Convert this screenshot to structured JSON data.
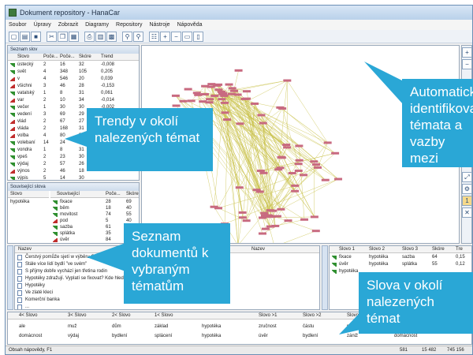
{
  "window": {
    "title": "Dokument repository - HanaCar"
  },
  "menu": [
    "Soubor",
    "Úpravy",
    "Zobrazit",
    "Diagramy",
    "Repository",
    "Nástroje",
    "Nápověda"
  ],
  "words_panel": {
    "header": "Seznam slov",
    "columns": [
      "Slovo",
      "Poče...",
      "Poče...",
      "Skóre",
      "Trend"
    ],
    "rows": [
      {
        "trend": "up",
        "cells": [
          "ústecký",
          "2",
          "16",
          "32",
          "-0,008"
        ]
      },
      {
        "trend": "up",
        "cells": [
          "svět",
          "4",
          "348",
          "105",
          "0,205"
        ]
      },
      {
        "trend": "down",
        "cells": [
          "v",
          "4",
          "546",
          "20",
          "0,039"
        ]
      },
      {
        "trend": "down",
        "cells": [
          "všichni",
          "3",
          "46",
          "28",
          "-0,153"
        ]
      },
      {
        "trend": "up",
        "cells": [
          "vatalský",
          "1",
          "8",
          "31",
          "0,061"
        ]
      },
      {
        "trend": "down",
        "cells": [
          "var",
          "2",
          "10",
          "34",
          "-0,014"
        ]
      },
      {
        "trend": "up",
        "cells": [
          "večer",
          "1",
          "30",
          "30",
          "-0,002"
        ]
      },
      {
        "trend": "up",
        "cells": [
          "vedení",
          "3",
          "69",
          "29",
          "0,151"
        ]
      },
      {
        "trend": "down",
        "cells": [
          "vlád",
          "2",
          "67",
          "27",
          ""
        ]
      },
      {
        "trend": "down",
        "cells": [
          "vláda",
          "2",
          "168",
          "31",
          ""
        ]
      },
      {
        "trend": "down",
        "cells": [
          "volba",
          "4",
          "80",
          "36",
          ""
        ]
      },
      {
        "trend": "up",
        "cells": [
          "volebaní",
          "14",
          "24",
          "30",
          ""
        ]
      },
      {
        "trend": "up",
        "cells": [
          "vondra",
          "1",
          "8",
          "31",
          ""
        ]
      },
      {
        "trend": "up",
        "cells": [
          "vpeš",
          "2",
          "23",
          "30",
          ""
        ]
      },
      {
        "trend": "up",
        "cells": [
          "výdaj",
          "2",
          "57",
          "26",
          ""
        ]
      },
      {
        "trend": "down",
        "cells": [
          "výnos",
          "2",
          "46",
          "18",
          ""
        ]
      },
      {
        "trend": "up",
        "cells": [
          "výpis",
          "5",
          "14",
          "30",
          ""
        ]
      }
    ]
  },
  "related_panel": {
    "header": "Související slova",
    "columns_left": [
      "Slovo"
    ],
    "left_rows": [
      "hypotéka"
    ],
    "columns_right": [
      "Související",
      "Poče...",
      "Skóre"
    ],
    "rows": [
      {
        "trend": "up",
        "cells": [
          "fixace",
          "28",
          "69"
        ]
      },
      {
        "trend": "up",
        "cells": [
          "běm",
          "18",
          "40"
        ]
      },
      {
        "trend": "up",
        "cells": [
          "movitost",
          "74",
          "55"
        ]
      },
      {
        "trend": "down",
        "cells": [
          "pod",
          "5",
          "40"
        ]
      },
      {
        "trend": "up",
        "cells": [
          "sazba",
          "61",
          "46"
        ]
      },
      {
        "trend": "up",
        "cells": [
          "splátka",
          "35",
          "45"
        ]
      },
      {
        "trend": "down",
        "cells": [
          "úvěr",
          "84",
          "45"
        ]
      }
    ]
  },
  "documents_panel": {
    "header": "Nazev",
    "col2": "Nazev",
    "rows": [
      "Čerstvý pomůže sjetí w výběru Obcemi ...",
      "Stále více lidí bydlí \"ve svém\"",
      "S příjmy dobře vychází jen třetina rodin",
      "Hypotéky zdražují. Vyplatí se fixovat? Kde hledat...",
      "Hypotéky",
      "Ve zlaté kleci",
      "Komerční banka",
      "..."
    ]
  },
  "pairs_panel": {
    "columns": [
      "Slovo 1",
      "Slovo 2",
      "Slovo 3",
      "Skóre",
      "Tre"
    ],
    "rows": [
      {
        "trend": "up",
        "cells": [
          "fixace",
          "hypotéka",
          "sazba",
          "64",
          "0,15"
        ]
      },
      {
        "trend": "up",
        "cells": [
          "úvěr",
          "hypotéka",
          "splátka",
          "55",
          "0,12"
        ]
      },
      {
        "trend": "up",
        "cells": [
          "hypotéka",
          "",
          "",
          "",
          ""
        ]
      }
    ]
  },
  "context_panel": {
    "columns": [
      "4< Slovo",
      "3< Slovo",
      "2< Slovo",
      "1< Slovo",
      "",
      "Slovo >1",
      "Slovo >2",
      "Slovo >3",
      "Slovo >4"
    ],
    "rows": [
      [
        "ale",
        "muž",
        "dům",
        "základ",
        "hypotéka",
        "zručnost",
        "částu",
        "po",
        "sumáření"
      ],
      [
        "domácnost",
        "výdaj",
        "bydlení",
        "splácení",
        "hypotéka",
        "úvěr",
        "bydlení",
        "zániž",
        "domácnost"
      ]
    ]
  },
  "status": {
    "left": "Obsah nápovědy, F1",
    "values": [
      "581",
      "15 482",
      "745 156"
    ]
  },
  "callouts": {
    "trends": "Trendy v okolí nalezených témat",
    "auto": "Automaticky identifikovaná témata a vazby mezi nimi",
    "docs": "Seznam dokumentů k vybraným tématům",
    "words": "Slova v okolí nalezených témat"
  },
  "colors": {
    "callout": "#2aa7d6",
    "trend_up": "#2f8f2f",
    "trend_down": "#c02c2c",
    "node": "#c86a80",
    "edge": "#c9c24a"
  }
}
